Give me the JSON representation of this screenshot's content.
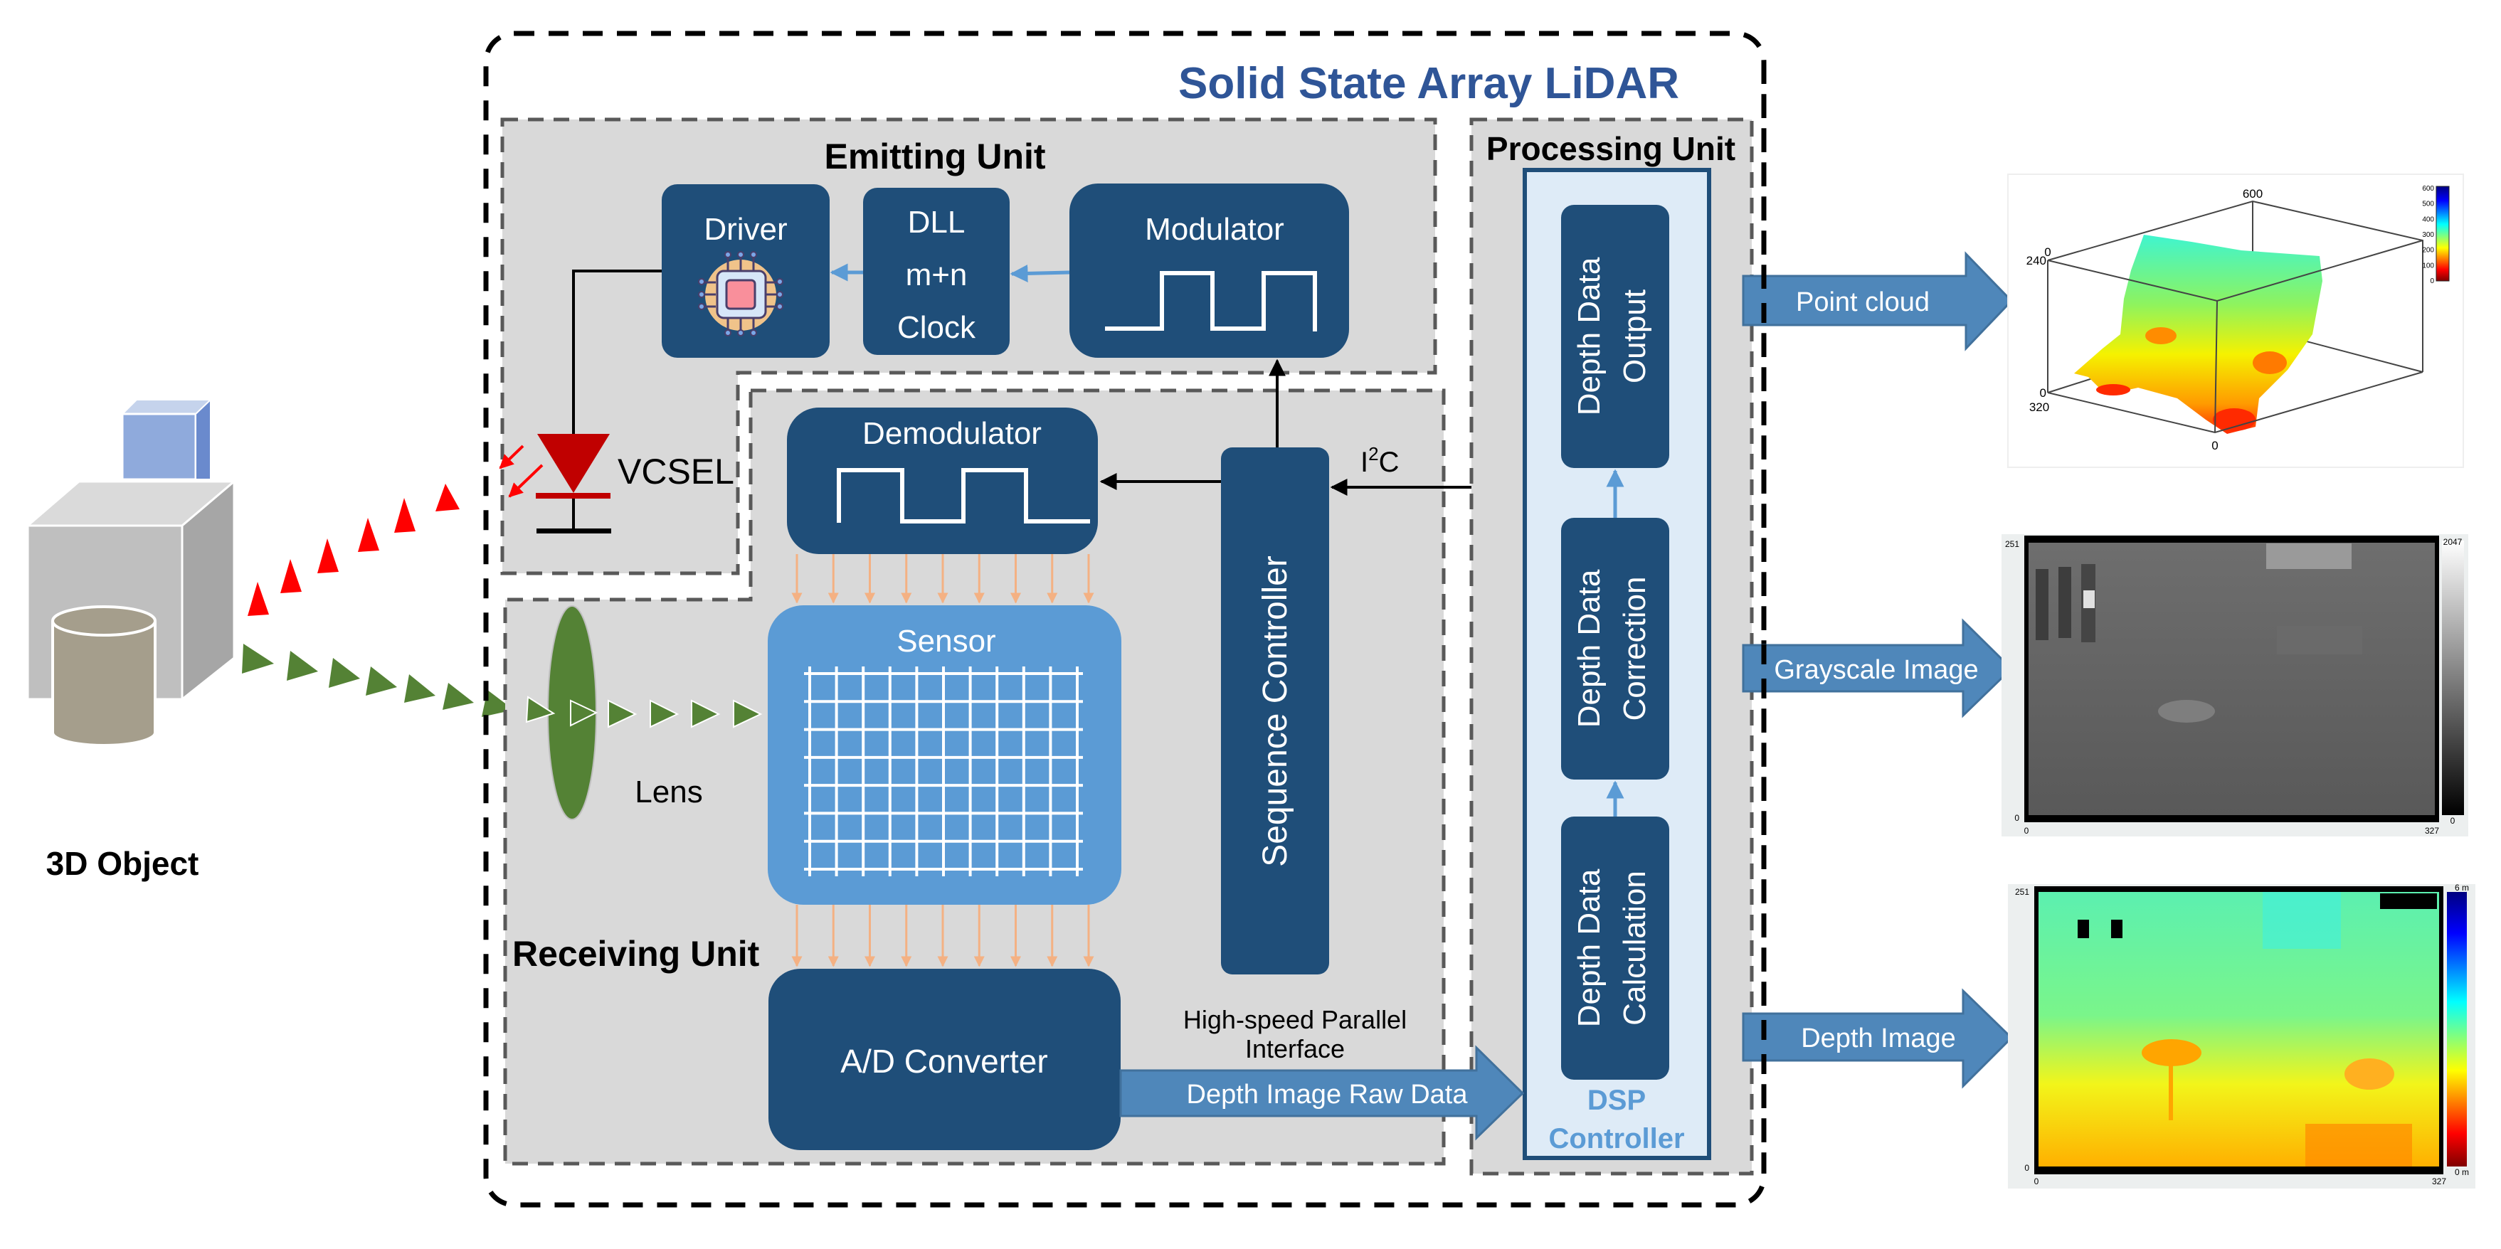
{
  "title": "Solid State Array LiDAR",
  "colors": {
    "title_blue": "#2f5597",
    "block_navy": "#1f4e79",
    "sensor_blue": "#5b9bd5",
    "arrow_blue": "#4f87ba",
    "unit_gray": "#d9d9d9",
    "dsp_fill": "#deebf7",
    "dsp_label": "#5b9bd5",
    "vcsel_red": "#c00000",
    "emitted_red": "#ff0000",
    "received_green": "#548235",
    "sensor_link_orange": "#f4b183"
  },
  "object": {
    "label": "3D Object"
  },
  "emitting_unit": {
    "title": "Emitting Unit",
    "driver": {
      "label": "Driver",
      "icon": "chip-icon"
    },
    "dll": {
      "line1": "DLL",
      "line2": "m+n",
      "line3": "Clock"
    },
    "modulator": {
      "label": "Modulator",
      "icon": "square-wave-icon"
    },
    "vcsel": {
      "label": "VCSEL",
      "icon": "laser-diode-icon"
    }
  },
  "receiving_unit": {
    "title": "Receiving Unit",
    "lens_label": "Lens",
    "demodulator": {
      "label": "Demodulator",
      "icon": "square-wave-icon"
    },
    "sensor": {
      "label": "Sensor",
      "grid_rows": 8,
      "grid_cols": 10
    },
    "adc": {
      "label": "A/D Converter"
    },
    "sequence_controller": {
      "label": "Sequence Controller"
    },
    "interface_label_line1": "High-speed Parallel",
    "interface_label_line2": "Interface",
    "raw_data_arrow": "Depth Image Raw Data",
    "i2c_label": "I",
    "i2c_sup": "2",
    "i2c_suffix": "C"
  },
  "processing_unit": {
    "title": "Processing Unit",
    "dsp_label_line1": "DSP",
    "dsp_label_line2": "Controller",
    "blocks": [
      {
        "line1": "Depth Data",
        "line2": "Output"
      },
      {
        "line1": "Depth Data",
        "line2": "Correction"
      },
      {
        "line1": "Depth Data",
        "line2": "Calculation"
      }
    ]
  },
  "outputs": [
    {
      "arrow_label": "Point cloud",
      "kind": "point-cloud",
      "axis_labels": {
        "top": "600",
        "left_top": "240",
        "left_top_zero": "0",
        "left_bottom": "0",
        "left_bottom_2": "320",
        "bottom": "0"
      },
      "colorbar_ticks": [
        "600",
        "500",
        "400",
        "300",
        "200",
        "100",
        "0"
      ]
    },
    {
      "arrow_label": "Grayscale Image",
      "kind": "grayscale",
      "y_max": "251",
      "y_min": "0",
      "x_min": "0",
      "x_max": "327",
      "colorbar_max": "2047",
      "colorbar_min": "0"
    },
    {
      "arrow_label": "Depth Image",
      "kind": "depth",
      "y_max": "251",
      "y_min": "0",
      "x_min": "0",
      "x_max": "327",
      "colorbar_max": "6 m",
      "colorbar_min": "0 m"
    }
  ]
}
